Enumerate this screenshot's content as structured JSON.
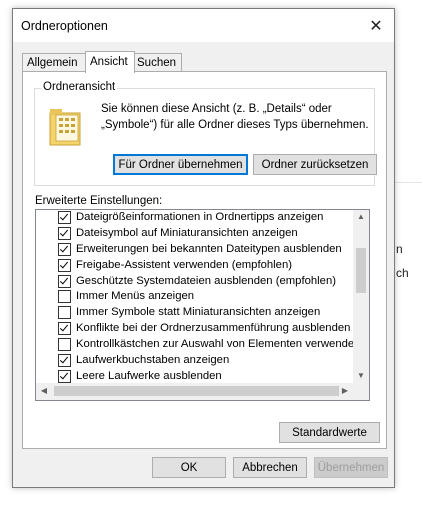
{
  "background": {
    "fragments": [
      "n",
      "ch"
    ]
  },
  "dialog": {
    "title": "Ordneroptionen",
    "close_glyph": "✕",
    "tabs": [
      {
        "label": "Allgemein",
        "active": false
      },
      {
        "label": "Ansicht",
        "active": true
      },
      {
        "label": "Suchen",
        "active": false
      }
    ],
    "folder_view": {
      "legend": "Ordneransicht",
      "icon": "folder-view-icon",
      "description": "Sie können diese Ansicht (z. B. „Details“ oder „Symbole“) für alle Ordner dieses Typs übernehmen.",
      "apply_button": "Für Ordner übernehmen",
      "reset_button": "Ordner zurücksetzen"
    },
    "advanced": {
      "label": "Erweiterte Einstellungen:",
      "items": [
        {
          "label": "Dateigrößeinformationen in Ordnertipps anzeigen",
          "checked": true
        },
        {
          "label": "Dateisymbol auf Miniaturansichten anzeigen",
          "checked": true
        },
        {
          "label": "Erweiterungen bei bekannten Dateitypen ausblenden",
          "checked": true
        },
        {
          "label": "Freigabe-Assistent verwenden (empfohlen)",
          "checked": true
        },
        {
          "label": "Geschützte Systemdateien ausblenden (empfohlen)",
          "checked": true
        },
        {
          "label": "Immer Menüs anzeigen",
          "checked": false
        },
        {
          "label": "Immer Symbole statt Miniaturansichten anzeigen",
          "checked": false
        },
        {
          "label": "Konflikte bei der Ordnerzusammenführung ausblenden",
          "checked": true
        },
        {
          "label": "Kontrollkästchen zur Auswahl von Elementen verwenden",
          "checked": false
        },
        {
          "label": "Laufwerkbuchstaben anzeigen",
          "checked": true
        },
        {
          "label": "Leere Laufwerke ausblenden",
          "checked": true
        }
      ]
    },
    "defaults_button": "Standardwerte",
    "ok_button": "OK",
    "cancel_button": "Abbrechen",
    "apply_button": "Übernehmen"
  }
}
